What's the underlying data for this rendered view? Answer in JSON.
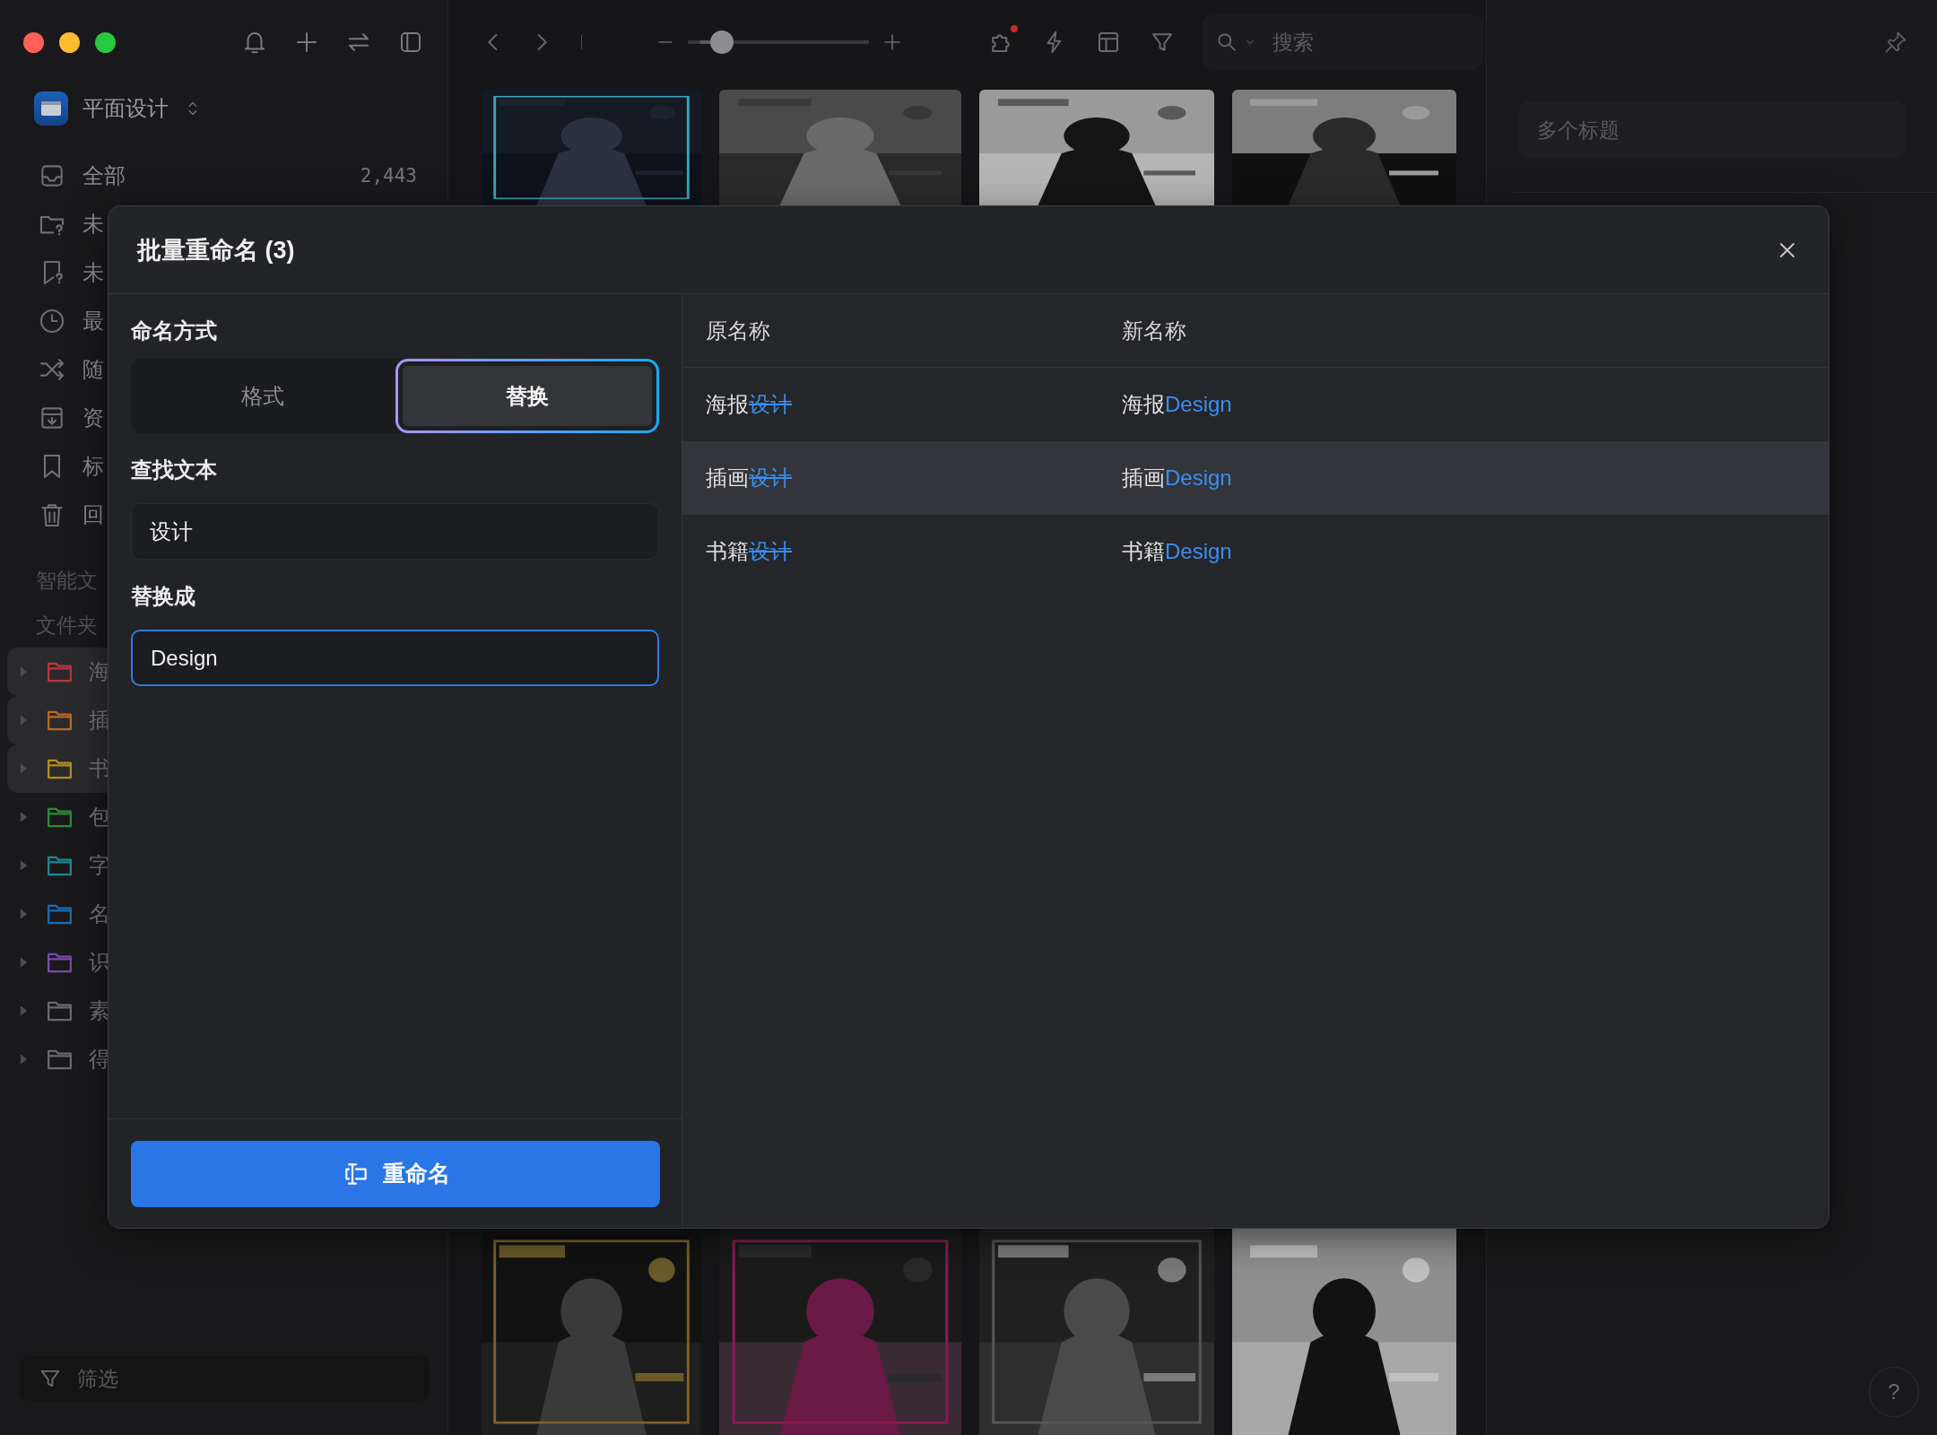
{
  "sidebar": {
    "tools": [
      {
        "kind": "bell"
      },
      {
        "kind": "plus"
      },
      {
        "kind": "swap"
      },
      {
        "kind": "sidebar"
      }
    ],
    "library": {
      "name": "平面设计"
    },
    "items": [
      {
        "kind": "inbox",
        "label": "全部",
        "count": "2,443"
      },
      {
        "kind": "folder-question",
        "label": "未"
      },
      {
        "kind": "tag-question",
        "label": "未"
      },
      {
        "kind": "clock",
        "label": "最"
      },
      {
        "kind": "shuffle",
        "label": "随"
      },
      {
        "kind": "archive",
        "label": "资"
      },
      {
        "kind": "bookmark",
        "label": "标"
      },
      {
        "kind": "trash",
        "label": "回"
      }
    ],
    "sections": [
      "智能文",
      "文件夹"
    ],
    "folders": [
      {
        "label": "海",
        "color": "#b8393e",
        "selected": true
      },
      {
        "label": "插",
        "color": "#b9691f",
        "selected": true
      },
      {
        "label": "书",
        "color": "#b48d1c",
        "selected": true
      },
      {
        "label": "包",
        "color": "#2f8a3b",
        "selected": false
      },
      {
        "label": "字",
        "color": "#1f8794",
        "selected": false
      },
      {
        "label": "名",
        "color": "#1d6bb0",
        "selected": false
      },
      {
        "label": "识",
        "color": "#774bab",
        "selected": false
      },
      {
        "label": "素",
        "color": "#6a6a6d",
        "selected": false
      },
      {
        "label": "得",
        "color": "#6a6a6d",
        "selected": false
      }
    ],
    "filter": {
      "placeholder": "筛选"
    }
  },
  "toolbar": {
    "slider": {
      "level": 0.14
    },
    "tools": [
      {
        "kind": "puzzle",
        "badge": true
      },
      {
        "kind": "bolt",
        "badge": false
      },
      {
        "kind": "layout",
        "badge": false
      },
      {
        "kind": "filter",
        "badge": false
      }
    ],
    "search": {
      "placeholder": "搜索"
    }
  },
  "inspector": {
    "title_field": {
      "placeholder": "多个标题"
    },
    "help": "?"
  },
  "dialog": {
    "title": "批量重命名 (3)",
    "method_label": "命名方式",
    "methods": [
      {
        "label": "格式",
        "selected": false
      },
      {
        "label": "替换",
        "selected": true
      }
    ],
    "find_label": "查找文本",
    "find": {
      "value": "设计",
      "focused": false
    },
    "replace_label": "替换成",
    "replace": {
      "value": "Design",
      "focused": true
    },
    "rename_button": "重命名",
    "columns": [
      "原名称",
      "新名称"
    ],
    "rows": [
      {
        "base": "海报",
        "removed": "设计",
        "new_base": "海报",
        "added": "Design",
        "highlighted": false
      },
      {
        "base": "插画",
        "removed": "设计",
        "new_base": "插画",
        "added": "Design",
        "highlighted": true
      },
      {
        "base": "书籍",
        "removed": "设计",
        "new_base": "书籍",
        "added": "Design",
        "highlighted": false
      }
    ]
  }
}
